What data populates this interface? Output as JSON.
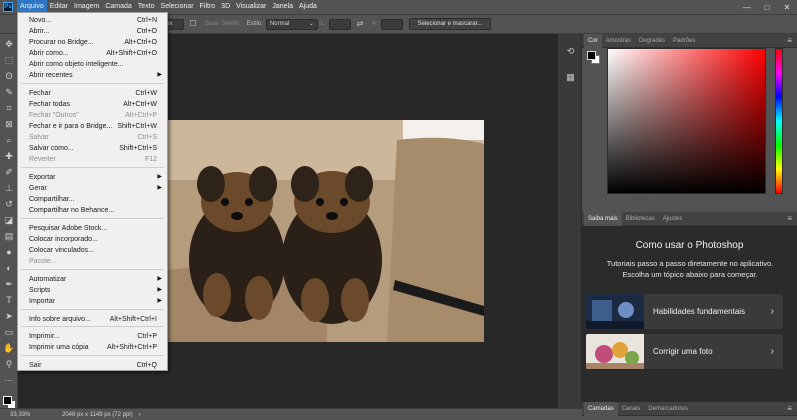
{
  "menubar": {
    "items": [
      "Arquivo",
      "Editar",
      "Imagem",
      "Camada",
      "Texto",
      "Selecionar",
      "Filtro",
      "3D",
      "Visualizar",
      "Janela",
      "Ajuda"
    ],
    "active_index": 0,
    "window_controls": [
      "—",
      "□",
      "✕"
    ]
  },
  "options_bar": {
    "size_value": "px",
    "smooth_label": "Suav. Serrilh.",
    "style_label": "Estilo:",
    "style_value": "Normal",
    "width_label": "L:",
    "height_label": "A:",
    "select_mask_button": "Selecionar e mascarar..."
  },
  "file_menu": {
    "items": [
      {
        "label": "Novo...",
        "shortcut": "Ctrl+N",
        "disabled": false,
        "submenu": false
      },
      {
        "label": "Abrir...",
        "shortcut": "Ctrl+O",
        "disabled": false,
        "submenu": false
      },
      {
        "label": "Procurar no Bridge...",
        "shortcut": "Alt+Ctrl+O",
        "disabled": false,
        "submenu": false
      },
      {
        "label": "Abrir como...",
        "shortcut": "Alt+Shift+Ctrl+O",
        "disabled": false,
        "submenu": false
      },
      {
        "label": "Abrir como objeto inteligente...",
        "shortcut": "",
        "disabled": false,
        "submenu": false
      },
      {
        "label": "Abrir recentes",
        "shortcut": "",
        "disabled": false,
        "submenu": true
      },
      {
        "label": "Fechar",
        "shortcut": "Ctrl+W",
        "disabled": false,
        "submenu": false
      },
      {
        "label": "Fechar todas",
        "shortcut": "Alt+Ctrl+W",
        "disabled": false,
        "submenu": false
      },
      {
        "label": "Fechar \"Outros\"",
        "shortcut": "Alt+Ctrl+P",
        "disabled": true,
        "submenu": false
      },
      {
        "label": "Fechar e ir para o Bridge...",
        "shortcut": "Shift+Ctrl+W",
        "disabled": false,
        "submenu": false
      },
      {
        "label": "Salvar",
        "shortcut": "Ctrl+S",
        "disabled": true,
        "submenu": false
      },
      {
        "label": "Salvar como...",
        "shortcut": "Shift+Ctrl+S",
        "disabled": false,
        "submenu": false
      },
      {
        "label": "Reverter",
        "shortcut": "F12",
        "disabled": true,
        "submenu": false
      },
      {
        "label": "Exportar",
        "shortcut": "",
        "disabled": false,
        "submenu": true
      },
      {
        "label": "Gerar",
        "shortcut": "",
        "disabled": false,
        "submenu": true
      },
      {
        "label": "Compartilhar...",
        "shortcut": "",
        "disabled": false,
        "submenu": false
      },
      {
        "label": "Compartilhar no Behance...",
        "shortcut": "",
        "disabled": false,
        "submenu": false
      },
      {
        "label": "Pesquisar Adobe Stock...",
        "shortcut": "",
        "disabled": false,
        "submenu": false
      },
      {
        "label": "Colocar incorporado...",
        "shortcut": "",
        "disabled": false,
        "submenu": false
      },
      {
        "label": "Colocar vinculados...",
        "shortcut": "",
        "disabled": false,
        "submenu": false
      },
      {
        "label": "Pacote...",
        "shortcut": "",
        "disabled": true,
        "submenu": false
      },
      {
        "label": "Automatizar",
        "shortcut": "",
        "disabled": false,
        "submenu": true
      },
      {
        "label": "Scripts",
        "shortcut": "",
        "disabled": false,
        "submenu": true
      },
      {
        "label": "Importar",
        "shortcut": "",
        "disabled": false,
        "submenu": true
      },
      {
        "label": "Info sobre arquivo...",
        "shortcut": "Alt+Shift+Ctrl+I",
        "disabled": false,
        "submenu": false
      },
      {
        "label": "Imprimir...",
        "shortcut": "Ctrl+P",
        "disabled": false,
        "submenu": false
      },
      {
        "label": "Imprimir uma cópia",
        "shortcut": "Alt+Shift+Ctrl+P",
        "disabled": false,
        "submenu": false
      },
      {
        "label": "Sair",
        "shortcut": "Ctrl+Q",
        "disabled": false,
        "submenu": false
      }
    ]
  },
  "color_panel": {
    "tabs": [
      "Cor",
      "Amostras",
      "Degradês",
      "Padrões"
    ],
    "foreground": "#000000",
    "background": "#ffffff"
  },
  "learn_panel": {
    "tabs": [
      "Saiba mais",
      "Bibliotecas",
      "Ajustes"
    ],
    "title": "Como usar o Photoshop",
    "description": "Tutoriais passo a passo diretamente no aplicativo. Escolha um tópico abaixo para começar.",
    "cards": [
      {
        "label": "Habilidades fundamentais"
      },
      {
        "label": "Corrigir uma foto"
      }
    ]
  },
  "layers_panel": {
    "tabs": [
      "Camadas",
      "Canais",
      "Demarcadores"
    ]
  },
  "status": {
    "zoom": "33,33%",
    "doc_info": "2048 px x 1149 px (72 ppi)",
    "arrow": "›"
  },
  "colors": {
    "accent": "#2f78c6",
    "menu_bg": "#f0f0f0",
    "chrome": "#535353"
  }
}
